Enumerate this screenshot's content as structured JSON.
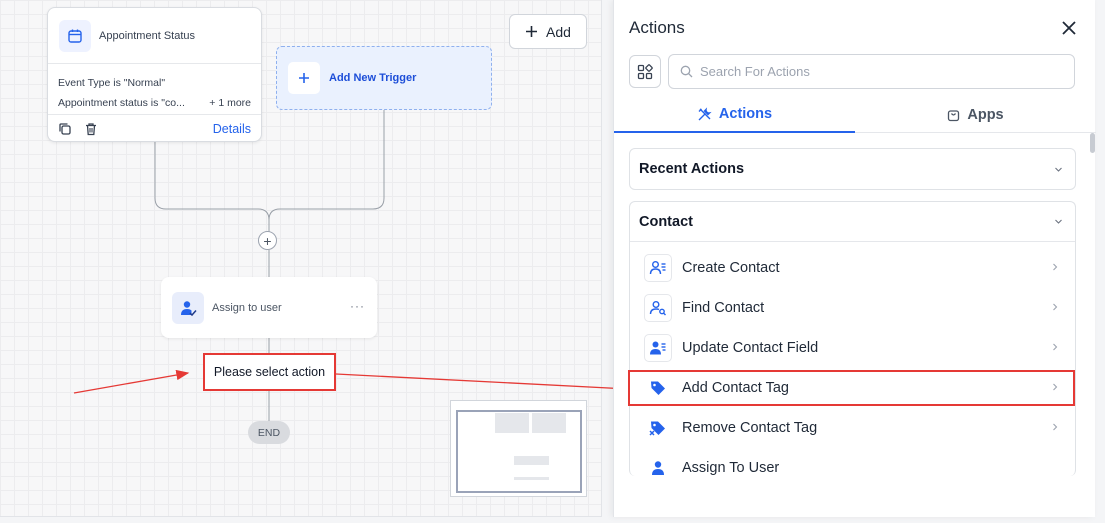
{
  "canvas": {
    "trigger": {
      "title": "Appointment Status",
      "conditions": [
        "Event Type is \"Normal\"",
        "Appointment status is \"co..."
      ],
      "more": "+ 1 more",
      "details_label": "Details"
    },
    "add_trigger_label": "Add New Trigger",
    "add_button_label": "Add",
    "action_step_title": "Assign to user",
    "action_menu": "···",
    "placeholder_label": "Please select action",
    "end_label": "END",
    "add_step_symbol": "+"
  },
  "panel": {
    "title": "Actions",
    "search_placeholder": "Search For Actions",
    "tabs": [
      {
        "label": "Actions",
        "icon": "tools-icon",
        "active": true
      },
      {
        "label": "Apps",
        "icon": "bag-icon",
        "active": false
      }
    ],
    "sections": {
      "recent": {
        "label": "Recent Actions"
      },
      "contact": {
        "label": "Contact",
        "items": [
          {
            "label": "Create Contact",
            "icon": "contact-list-icon"
          },
          {
            "label": "Find Contact",
            "icon": "contact-search-icon"
          },
          {
            "label": "Update Contact Field",
            "icon": "contact-update-icon"
          },
          {
            "label": "Add Contact Tag",
            "icon": "tag-icon"
          },
          {
            "label": "Remove Contact Tag",
            "icon": "tag-remove-icon"
          },
          {
            "label": "Assign To User",
            "icon": "assign-user-icon"
          }
        ]
      }
    }
  },
  "colors": {
    "accent": "#2563eb",
    "annotation_red": "#e53935"
  }
}
